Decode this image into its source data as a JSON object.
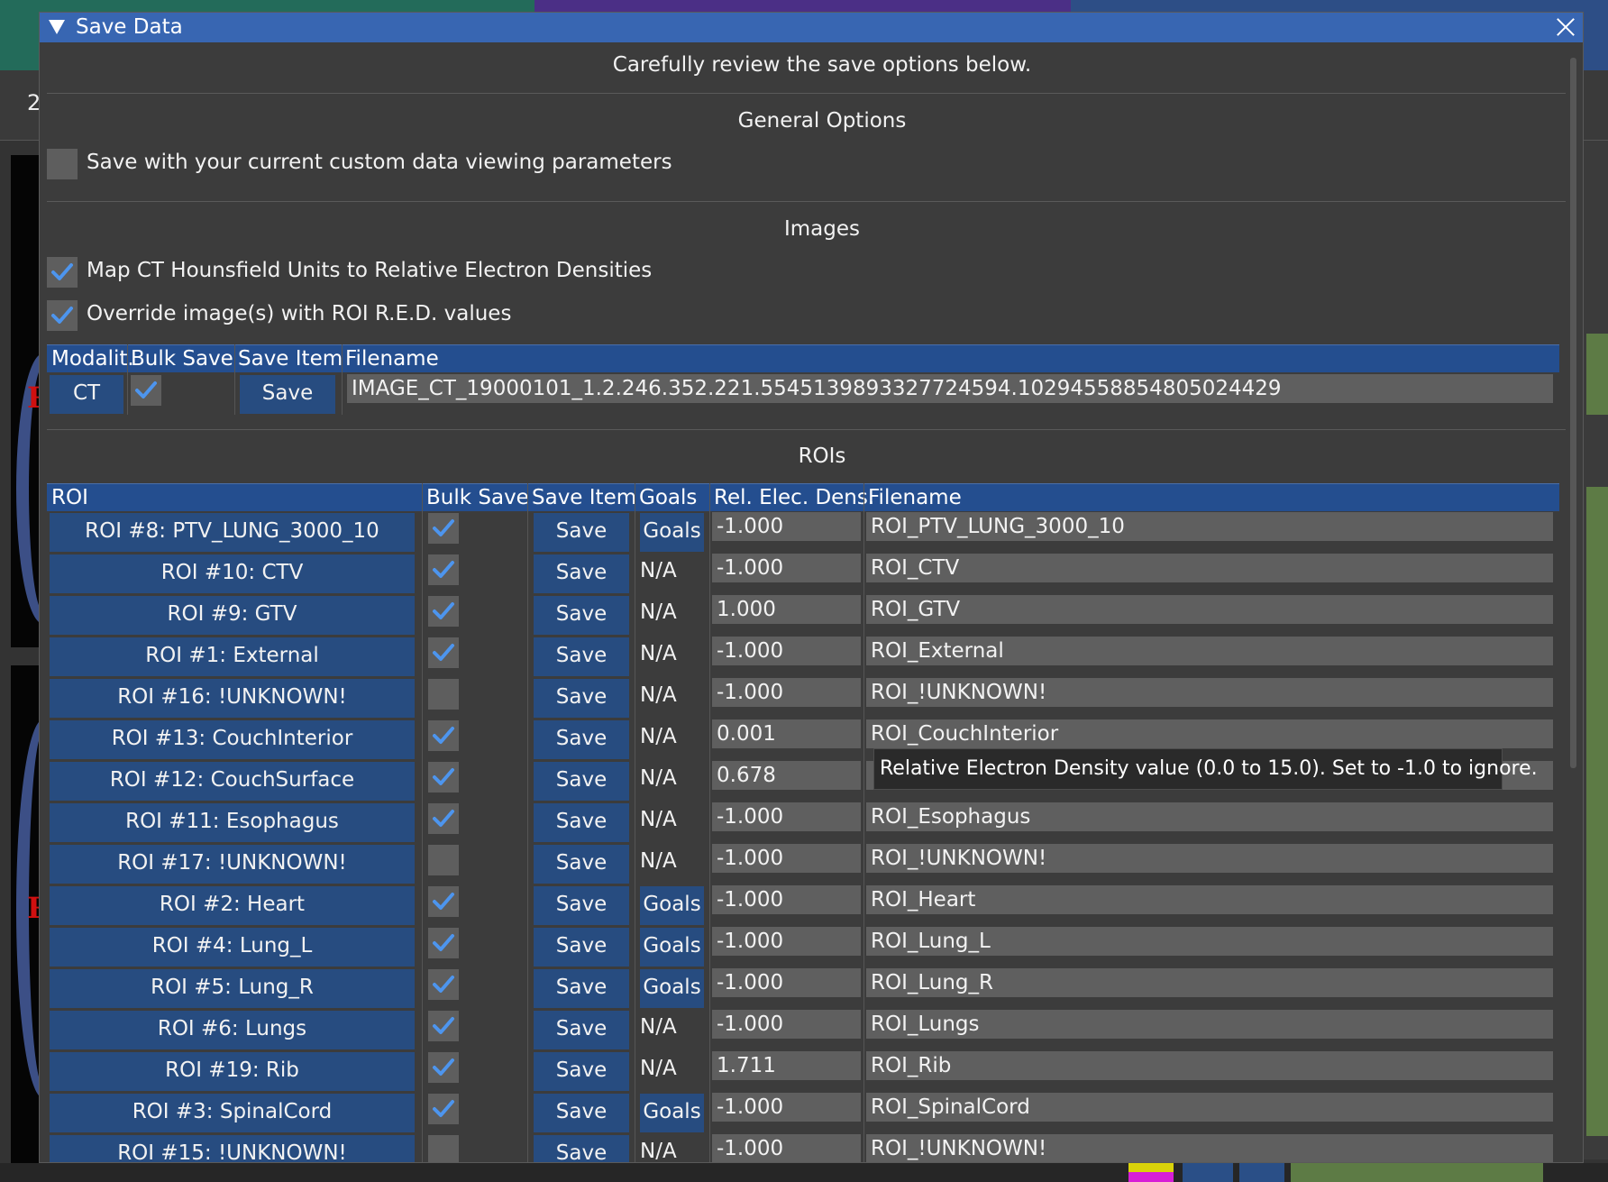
{
  "background": {
    "header_number": "2",
    "orientation_marker": "R"
  },
  "dialog": {
    "title": "Save Data",
    "intro": "Carefully review the save options below.",
    "general_heading": "General Options",
    "custom_params_label": "Save with your current custom data viewing parameters",
    "custom_params_checked": false,
    "images_heading": "Images",
    "map_ct_label": "Map CT Hounsfield Units to Relative Electron Densities",
    "map_ct_checked": true,
    "override_label": "Override image(s) with ROI R.E.D. values",
    "override_checked": true,
    "rois_heading": "ROIs"
  },
  "images_table": {
    "headers": [
      "Modalit.",
      "Bulk Save",
      "Save Item",
      "Filename"
    ],
    "rows": [
      {
        "modality": "CT",
        "bulk_save": true,
        "save_label": "Save",
        "filename": "IMAGE_CT_19000101_1.2.246.352.221.5545139893327724594.10294558854805024429"
      }
    ]
  },
  "roi_table": {
    "headers": [
      "ROI",
      "Bulk Save",
      "Save Item",
      "Goals",
      "Rel. Elec. Dens.",
      "Filename"
    ],
    "rows": [
      {
        "roi": "ROI #8: PTV_LUNG_3000_10",
        "bulk": true,
        "save": "Save",
        "goals": "Goals",
        "red": "-1.000",
        "filename": "ROI_PTV_LUNG_3000_10"
      },
      {
        "roi": "ROI #10: CTV",
        "bulk": true,
        "save": "Save",
        "goals": "N/A",
        "red": "-1.000",
        "filename": "ROI_CTV"
      },
      {
        "roi": "ROI #9: GTV",
        "bulk": true,
        "save": "Save",
        "goals": "N/A",
        "red": "1.000",
        "filename": "ROI_GTV"
      },
      {
        "roi": "ROI #1: External",
        "bulk": true,
        "save": "Save",
        "goals": "N/A",
        "red": "-1.000",
        "filename": "ROI_External"
      },
      {
        "roi": "ROI #16: !UNKNOWN!",
        "bulk": false,
        "save": "Save",
        "goals": "N/A",
        "red": "-1.000",
        "filename": "ROI_!UNKNOWN!"
      },
      {
        "roi": "ROI #13: CouchInterior",
        "bulk": true,
        "save": "Save",
        "goals": "N/A",
        "red": "0.001",
        "filename": "ROI_CouchInterior"
      },
      {
        "roi": "ROI #12: CouchSurface",
        "bulk": true,
        "save": "Save",
        "goals": "N/A",
        "red": "0.678",
        "filename": ""
      },
      {
        "roi": "ROI #11: Esophagus",
        "bulk": true,
        "save": "Save",
        "goals": "N/A",
        "red": "-1.000",
        "filename": "ROI_Esophagus"
      },
      {
        "roi": "ROI #17: !UNKNOWN!",
        "bulk": false,
        "save": "Save",
        "goals": "N/A",
        "red": "-1.000",
        "filename": "ROI_!UNKNOWN!"
      },
      {
        "roi": "ROI #2: Heart",
        "bulk": true,
        "save": "Save",
        "goals": "Goals",
        "red": "-1.000",
        "filename": "ROI_Heart"
      },
      {
        "roi": "ROI #4: Lung_L",
        "bulk": true,
        "save": "Save",
        "goals": "Goals",
        "red": "-1.000",
        "filename": "ROI_Lung_L"
      },
      {
        "roi": "ROI #5: Lung_R",
        "bulk": true,
        "save": "Save",
        "goals": "Goals",
        "red": "-1.000",
        "filename": "ROI_Lung_R"
      },
      {
        "roi": "ROI #6: Lungs",
        "bulk": true,
        "save": "Save",
        "goals": "N/A",
        "red": "-1.000",
        "filename": "ROI_Lungs"
      },
      {
        "roi": "ROI #19: Rib",
        "bulk": true,
        "save": "Save",
        "goals": "N/A",
        "red": "1.711",
        "filename": "ROI_Rib"
      },
      {
        "roi": "ROI #3: SpinalCord",
        "bulk": true,
        "save": "Save",
        "goals": "Goals",
        "red": "-1.000",
        "filename": "ROI_SpinalCord"
      },
      {
        "roi": "ROI #15: !UNKNOWN!",
        "bulk": false,
        "save": "Save",
        "goals": "N/A",
        "red": "-1.000",
        "filename": "ROI_!UNKNOWN!"
      }
    ]
  },
  "tooltip": "Relative Electron Density value (0.0 to 15.0). Set to -1.0 to ignore.",
  "colors": {
    "title_bar": "#3866b2",
    "header_bar": "#244e8f",
    "button": "#274c80",
    "checkmark": "#4d95ee",
    "field": "#5f5f5f"
  }
}
